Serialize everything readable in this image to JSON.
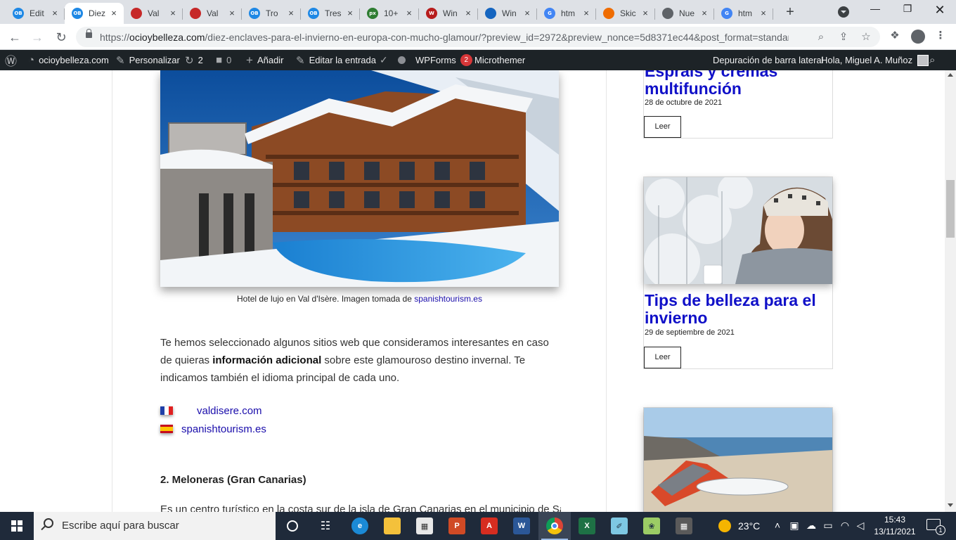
{
  "browser": {
    "tabs": [
      {
        "title": "Edit",
        "favicon": "OB",
        "color": "#1e88e5"
      },
      {
        "title": "Diez",
        "favicon": "OB",
        "color": "#1e88e5",
        "active": true
      },
      {
        "title": "Val",
        "favicon": "",
        "color": "#c62828"
      },
      {
        "title": "Val",
        "favicon": "",
        "color": "#c62828"
      },
      {
        "title": "Tro",
        "favicon": "OB",
        "color": "#1e88e5"
      },
      {
        "title": "Tres",
        "favicon": "OB",
        "color": "#1e88e5"
      },
      {
        "title": "10+",
        "favicon": "px",
        "color": "#2e7d32"
      },
      {
        "title": "Win",
        "favicon": "W",
        "color": "#b71c1c"
      },
      {
        "title": "Win",
        "favicon": "",
        "color": "#1565c0"
      },
      {
        "title": "htm",
        "favicon": "G",
        "color": "#4285f4"
      },
      {
        "title": "Skic",
        "favicon": "",
        "color": "#ef6c00"
      },
      {
        "title": "Nue",
        "favicon": "",
        "color": "#5f6368"
      },
      {
        "title": "htm",
        "favicon": "G",
        "color": "#4285f4"
      }
    ],
    "url_prefix": "https://",
    "url_domain": "ocioybelleza.com",
    "url_rest": "/diez-enclaves-para-el-invierno-en-europa-con-mucho-glamour/?preview_id=2972&preview_nonce=5d8371ec44&post_format=standar...",
    "new_tab": "+",
    "close": "×"
  },
  "adminbar": {
    "site": "ocioybelleza.com",
    "customize": "Personalizar",
    "updates": "2",
    "comments": "0",
    "add": "Añadir",
    "edit": "Editar la entrada",
    "wpforms": "WPForms",
    "wpforms_badge": "2",
    "microthemer": "Microthemer",
    "debug": "Depuración de barra lateral",
    "greeting": "Hola, Miguel A. Muñoz"
  },
  "article": {
    "caption_text": "Hotel de lujo en Val d'Isère. Imagen tomada de ",
    "caption_link": "spanishtourism.es",
    "para_1": "Te hemos seleccionado algunos sitios web que consideramos interesantes en caso de quieras ",
    "para_bold": "información adicional",
    "para_2": " sobre este glamouroso destino invernal. Te indicamos también el idioma principal de cada uno.",
    "links": [
      {
        "flag": "fr",
        "text": "valdisere.com"
      },
      {
        "flag": "es",
        "text": "spanishtourism.es"
      }
    ],
    "heading": "2. Meloneras (Gran Canarias)",
    "clipped_text": "Es un centro turístico en la costa sur de la isla de Gran Canarias en el municipio de San"
  },
  "sidebar": {
    "cards": [
      {
        "title": "Esprais y cremas multifunción",
        "date": "28 de octubre de 2021",
        "button": "Leer"
      },
      {
        "title": "Tips de belleza para el invierno",
        "date": "29 de septiembre de 2021",
        "button": "Leer"
      },
      {
        "title": "",
        "date": "",
        "button": ""
      }
    ]
  },
  "taskbar": {
    "search_placeholder": "Escribe aquí para buscar",
    "weather": "23°C",
    "time": "15:43",
    "date": "13/11/2021",
    "notifications": "1"
  }
}
